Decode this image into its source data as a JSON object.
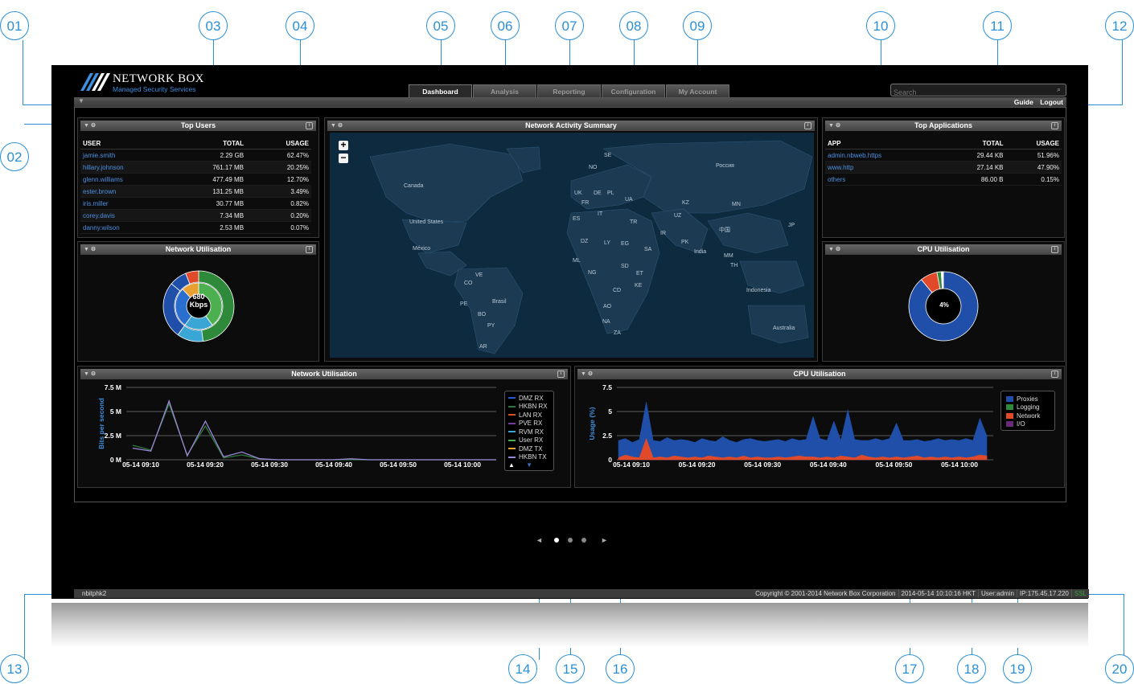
{
  "callouts": [
    "01",
    "02",
    "03",
    "04",
    "05",
    "06",
    "07",
    "08",
    "09",
    "10",
    "11",
    "12",
    "13",
    "14",
    "15",
    "16",
    "17",
    "18",
    "19",
    "20"
  ],
  "brand": {
    "title": "NETWORK BOX",
    "subtitle": "Managed Security Services"
  },
  "tabs": [
    {
      "label": "Dashboard"
    },
    {
      "label": "Analysis"
    },
    {
      "label": "Reporting"
    },
    {
      "label": "Configuration"
    },
    {
      "label": "My Account"
    }
  ],
  "search": {
    "placeholder": "Search",
    "icon": "search-icon"
  },
  "nav": {
    "guide": "Guide",
    "logout": "Logout"
  },
  "top_users": {
    "title": "Top Users",
    "columns": [
      "USER",
      "TOTAL",
      "USAGE"
    ],
    "rows": [
      [
        "jamie.smith",
        "2.29 GB",
        "62.47%"
      ],
      [
        "hillary.johnson",
        "761.17 MB",
        "20.25%"
      ],
      [
        "glenn.williams",
        "477.49 MB",
        "12.70%"
      ],
      [
        "ester.brown",
        "131.25 MB",
        "3.49%"
      ],
      [
        "iris.miller",
        "30.77 MB",
        "0.82%"
      ],
      [
        "corey.davis",
        "7.34 MB",
        "0.20%"
      ],
      [
        "danny.wilson",
        "2.53 MB",
        "0.07%"
      ]
    ]
  },
  "network_summary": {
    "title": "Network Activity Summary",
    "zoom_in": "+",
    "zoom_out": "−",
    "labels": [
      "Canada",
      "United States",
      "México",
      "Brasil",
      "Россия",
      "India",
      "Indonesia",
      "Australia",
      "中国",
      "SE",
      "NO",
      "UK",
      "DE",
      "PL",
      "FR",
      "UA",
      "ES",
      "IT",
      "KZ",
      "TR",
      "UZ",
      "MN",
      "JP",
      "IR",
      "PK",
      "DZ",
      "LY",
      "EG",
      "SA",
      "ML",
      "NG",
      "SD",
      "ET",
      "TH",
      "MM",
      "CD",
      "KE",
      "AO",
      "NA",
      "ZA",
      "VE",
      "CO",
      "PE",
      "BO",
      "PY",
      "AR"
    ]
  },
  "top_apps": {
    "title": "Top Applications",
    "columns": [
      "APP",
      "TOTAL",
      "USAGE"
    ],
    "rows": [
      [
        "admin.nbweb.https",
        "29.44 KB",
        "51.96%"
      ],
      [
        "www.http",
        "27.14 KB",
        "47.90%"
      ],
      [
        "others",
        "86.00 B",
        "0.15%"
      ]
    ]
  },
  "net_util_small": {
    "title": "Network Utilisation",
    "center_value": "680",
    "center_unit": "Kbps"
  },
  "cpu_util_small": {
    "title": "CPU Utilisation",
    "center_value": "4%"
  },
  "net_util_chart": {
    "title": "Network Utilisation",
    "ylabel": "Bits per second",
    "yticks": [
      "7.5 M",
      "5 M",
      "2.5 M",
      "0 M"
    ],
    "xticks": [
      "05-14 09:10",
      "05-14 09:20",
      "05-14 09:30",
      "05-14 09:40",
      "05-14 09:50",
      "05-14 10:00"
    ],
    "legend": [
      {
        "name": "DMZ RX",
        "color": "#2a5bd7"
      },
      {
        "name": "HKBN RX",
        "color": "#2e7a3a"
      },
      {
        "name": "LAN RX",
        "color": "#d6532a"
      },
      {
        "name": "PVE RX",
        "color": "#7a3aa0"
      },
      {
        "name": "RVM RX",
        "color": "#3aa6d6"
      },
      {
        "name": "User RX",
        "color": "#4caf50"
      },
      {
        "name": "DMZ TX",
        "color": "#e8a030"
      },
      {
        "name": "HKBN TX",
        "color": "#9a86d8"
      }
    ]
  },
  "cpu_util_chart": {
    "title": "CPU Utilisation",
    "ylabel": "Usage (%)",
    "yticks": [
      "7.5",
      "5",
      "2.5",
      "0"
    ],
    "xticks": [
      "05-14 09:10",
      "05-14 09:20",
      "05-14 09:30",
      "05-14 09:40",
      "05-14 09:50",
      "05-14 10:00"
    ],
    "legend": [
      {
        "name": "Proxies",
        "color": "#1f4fa8"
      },
      {
        "name": "Logging",
        "color": "#2e8a3a"
      },
      {
        "name": "Network",
        "color": "#e04a2a"
      },
      {
        "name": "I/O",
        "color": "#6a2a7a"
      }
    ]
  },
  "chart_data": [
    {
      "type": "pie",
      "title": "Network Utilisation",
      "center_label": "680 Kbps",
      "rings": [
        {
          "name": "outer",
          "values": [
            48,
            12,
            26,
            8,
            6
          ],
          "colors": [
            "#2e8a3a",
            "#3aa6d6",
            "#1f4fa8",
            "#1f4fa8",
            "#e04a2a"
          ]
        },
        {
          "name": "inner",
          "values": [
            40,
            20,
            28,
            12
          ],
          "colors": [
            "#4cb050",
            "#3aa6d6",
            "#2a6fd0",
            "#e8a030"
          ]
        }
      ]
    },
    {
      "type": "pie",
      "title": "CPU Utilisation",
      "center_label": "4%",
      "values": [
        89,
        8,
        2,
        1
      ],
      "colors": [
        "#1f4fa8",
        "#e04a2a",
        "#2e8a3a",
        "#ffffff"
      ]
    },
    {
      "type": "line",
      "title": "Network Utilisation",
      "ylabel": "Bits per second",
      "ylim": [
        0,
        7.5
      ],
      "x": [
        0,
        1,
        2,
        3,
        4,
        5,
        6,
        7,
        8,
        9,
        10,
        11,
        12,
        13,
        14,
        15,
        16,
        17,
        18,
        19,
        20
      ],
      "series": [
        {
          "name": "HKBN RX",
          "values": [
            1.5,
            1.0,
            5.8,
            0.5,
            3.5,
            0.2,
            0.5,
            0.1,
            0,
            0,
            0,
            0,
            0,
            0,
            0,
            0,
            0,
            0,
            0,
            0,
            0
          ]
        },
        {
          "name": "HKBN TX",
          "values": [
            1.2,
            0.9,
            6.1,
            0.4,
            4.0,
            0.3,
            0.8,
            0.1,
            0,
            0,
            0,
            0,
            0.1,
            0,
            0,
            0,
            0,
            0,
            0,
            0,
            0
          ]
        }
      ]
    },
    {
      "type": "area",
      "title": "CPU Utilisation",
      "ylabel": "Usage (%)",
      "ylim": [
        0,
        7.5
      ],
      "series": [
        {
          "name": "Proxies",
          "values": [
            2,
            2.2,
            1.8,
            2.1,
            6,
            2,
            1.9,
            2.3,
            2,
            2.1,
            2,
            1.8,
            2.2,
            2,
            1.9,
            2.4,
            2,
            1.8,
            2.1,
            2.2,
            2,
            1.9,
            2,
            2.1,
            1.9,
            2.2,
            2,
            2.1,
            4.5,
            2.2,
            2,
            4,
            2,
            5.2,
            2.1,
            2,
            2,
            2.2,
            2,
            2.2,
            3.8,
            2,
            2,
            2.1,
            1.9,
            2,
            2.2,
            2,
            2.1,
            2,
            2.2,
            2,
            4.3,
            2.5
          ]
        },
        {
          "name": "Network",
          "values": [
            0.2,
            0.5,
            0.3,
            0.2,
            2.2,
            0.2,
            0.3,
            0.2,
            0.4,
            0.3,
            0.2,
            0.3,
            0.2,
            0.4,
            0.3,
            0.2,
            0.3,
            0.2,
            0.4,
            0.2,
            0.3,
            0.2,
            0.2,
            0.3,
            0.2,
            0.3,
            0.4,
            0.3,
            0.3,
            0.2,
            0.3,
            0.2,
            0.4,
            0.3,
            0.2,
            0.5,
            0.3,
            0.2,
            0.3,
            0.2,
            0.3,
            0.2,
            0.3,
            0.4,
            0.2,
            0.3,
            0.2,
            0.3,
            0.2,
            0.3,
            0.2,
            0.3,
            0.5,
            0.4
          ]
        }
      ]
    }
  ],
  "pager": {
    "prev": "◄",
    "next": "►",
    "pages": 3,
    "current": 1
  },
  "footer": {
    "host": "nbitphk2",
    "copyright": "Copyright © 2001-2014 Network Box Corporation",
    "datetime": "2014-05-14 10:10:16 HKT",
    "user": "User:admin",
    "ip": "IP:175.45.17.220",
    "ssl": "SSL",
    "ssl_color": "#3aa03a"
  }
}
